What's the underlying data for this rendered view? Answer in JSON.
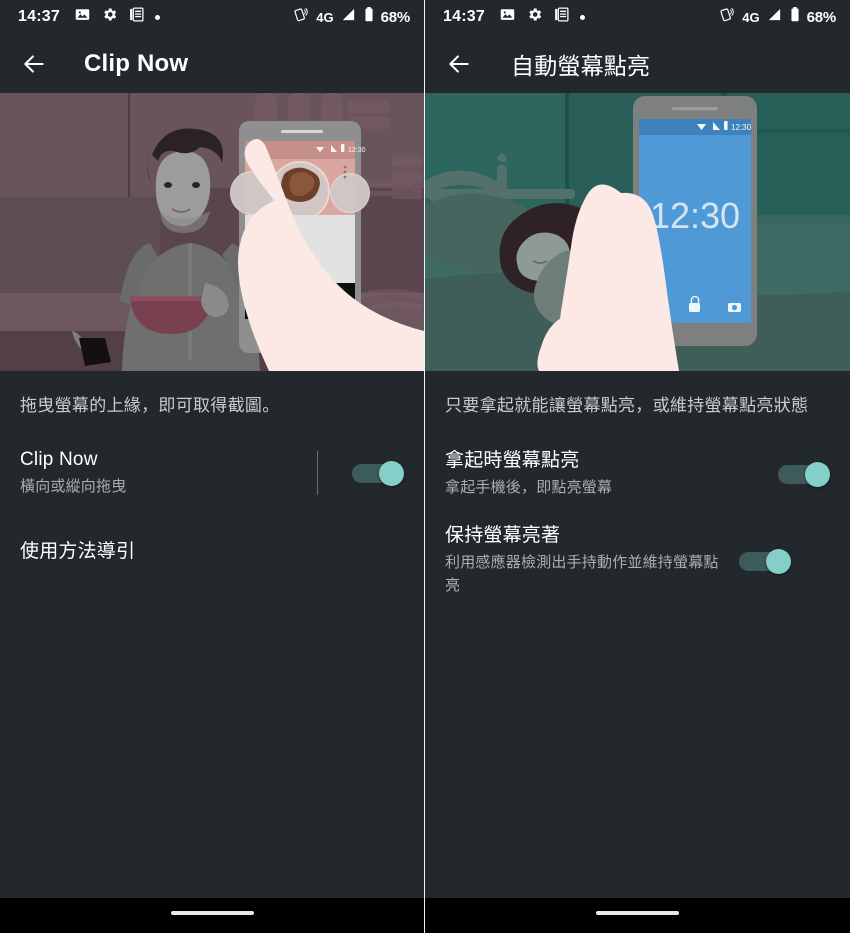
{
  "theme": {
    "background": "#23282c",
    "accent": "#84cfc7",
    "track": "#3e5b5b",
    "title_color": "#ffffff",
    "subtitle_color": "#a7aeb4",
    "nav_background": "#000000"
  },
  "panels": [
    {
      "status_bar": {
        "time": "14:37",
        "left_icons": [
          "image-icon",
          "gear-icon",
          "document-icon",
          "dot-icon"
        ],
        "right_icons": [
          "vibrate-icon",
          "signal-icon",
          "battery-icon"
        ],
        "network_label": "4G",
        "battery_percent": "68%"
      },
      "app_bar": {
        "back_label": "back-arrow-icon",
        "title": "Clip Now"
      },
      "hero": {
        "name": "clip-now-illustration",
        "base_color": "#5f4d54",
        "phone_time": "12:30"
      },
      "description": "拖曳螢幕的上緣，即可取得截圖。",
      "settings": [
        {
          "title": "Clip Now",
          "subtitle": "橫向或縱向拖曳",
          "toggle_state": "on",
          "has_divider": true
        }
      ],
      "links": [
        {
          "label": "使用方法導引"
        }
      ],
      "nav_bar": {
        "gesture_pill": "home-gesture-pill"
      }
    },
    {
      "status_bar": {
        "time": "14:37",
        "left_icons": [
          "image-icon",
          "gear-icon",
          "document-icon",
          "dot-icon"
        ],
        "right_icons": [
          "vibrate-icon",
          "signal-icon",
          "battery-icon"
        ],
        "network_label": "4G",
        "battery_percent": "68%"
      },
      "app_bar": {
        "back_label": "back-arrow-icon",
        "title": "自動螢幕點亮"
      },
      "hero": {
        "name": "auto-screen-on-illustration",
        "base_color": "#2f6b63",
        "phone_time": "12:30"
      },
      "description": "只要拿起就能讓螢幕點亮，或維持螢幕點亮狀態",
      "settings": [
        {
          "title": "拿起時螢幕點亮",
          "subtitle": "拿起手機後，即點亮螢幕",
          "toggle_state": "on",
          "has_divider": false
        },
        {
          "title": "保持螢幕亮著",
          "subtitle": "利用感應器檢測出手持動作並維持螢幕點亮",
          "toggle_state": "on",
          "has_divider": false
        }
      ],
      "links": [],
      "nav_bar": {
        "gesture_pill": "home-gesture-pill"
      }
    }
  ]
}
